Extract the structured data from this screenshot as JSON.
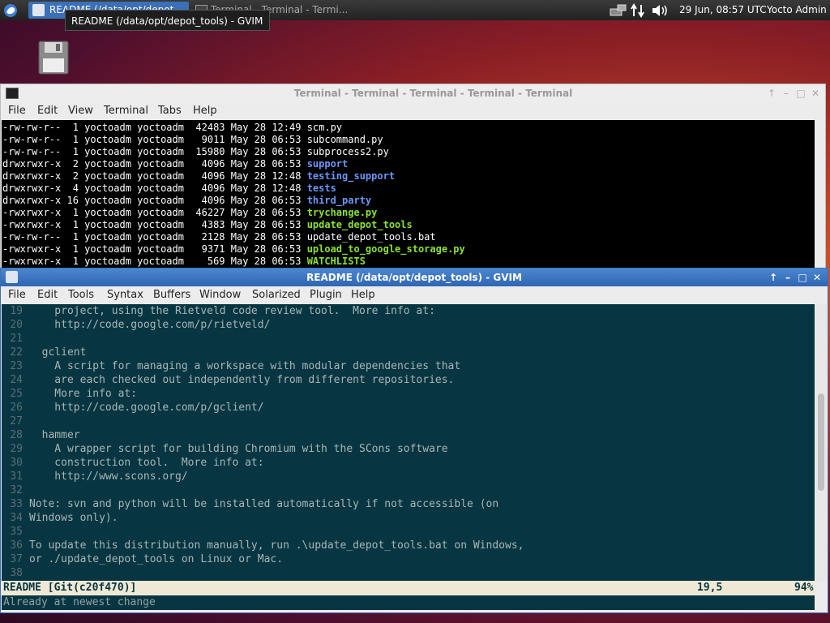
{
  "top_panel": {
    "tasks": [
      {
        "label": "README (/data/opt/depot..."
      },
      {
        "label": "Terminal - Terminal - Termi..."
      }
    ],
    "clock": "29 Jun, 08:57 UTC",
    "user": "Yocto Admin"
  },
  "tooltip": "README (/data/opt/depot_tools) - GVIM",
  "terminal": {
    "title": "Terminal - Terminal - Terminal - Terminal - Terminal",
    "menu": [
      "File",
      "Edit",
      "View",
      "Terminal",
      "Tabs",
      "Help"
    ],
    "rows": [
      {
        "meta": "-rw-rw-r--  1 yoctoadm yoctoadm  42483 May 28 12:49 ",
        "name": "scm.py",
        "kind": "file"
      },
      {
        "meta": "-rw-rw-r--  1 yoctoadm yoctoadm   9011 May 28 06:53 ",
        "name": "subcommand.py",
        "kind": "file"
      },
      {
        "meta": "-rw-rw-r--  1 yoctoadm yoctoadm  15980 May 28 06:53 ",
        "name": "subprocess2.py",
        "kind": "file"
      },
      {
        "meta": "drwxrwxr-x  2 yoctoadm yoctoadm   4096 May 28 06:53 ",
        "name": "support",
        "kind": "dir"
      },
      {
        "meta": "drwxrwxr-x  2 yoctoadm yoctoadm   4096 May 28 12:48 ",
        "name": "testing_support",
        "kind": "dir"
      },
      {
        "meta": "drwxrwxr-x  4 yoctoadm yoctoadm   4096 May 28 12:48 ",
        "name": "tests",
        "kind": "dir"
      },
      {
        "meta": "drwxrwxr-x 16 yoctoadm yoctoadm   4096 May 28 06:53 ",
        "name": "third_party",
        "kind": "dir"
      },
      {
        "meta": "-rwxrwxr-x  1 yoctoadm yoctoadm  46227 May 28 06:53 ",
        "name": "trychange.py",
        "kind": "exe"
      },
      {
        "meta": "-rwxrwxr-x  1 yoctoadm yoctoadm   4383 May 28 06:53 ",
        "name": "update_depot_tools",
        "kind": "exe"
      },
      {
        "meta": "-rw-rw-r--  1 yoctoadm yoctoadm   2128 May 28 06:53 ",
        "name": "update_depot_tools.bat",
        "kind": "file"
      },
      {
        "meta": "-rwxrwxr-x  1 yoctoadm yoctoadm   9371 May 28 06:53 ",
        "name": "upload_to_google_storage.py",
        "kind": "exe"
      },
      {
        "meta": "-rwxrwxr-x  1 yoctoadm yoctoadm    569 May 28 06:53 ",
        "name": "WATCHLISTS",
        "kind": "exe"
      }
    ]
  },
  "gvim": {
    "title": "README (/data/opt/depot_tools) - GVIM",
    "menu": [
      "File",
      "Edit",
      "Tools",
      "Syntax",
      "Buffers",
      "Window",
      "Solarized",
      "Plugin",
      "Help"
    ],
    "lines": [
      {
        "n": "19",
        "text": "    project, using the Rietveld code review tool.  More info at:"
      },
      {
        "n": "20",
        "text": "    http://code.google.com/p/rietveld/"
      },
      {
        "n": "21",
        "text": ""
      },
      {
        "n": "22",
        "text": "  gclient"
      },
      {
        "n": "23",
        "text": "    A script for managing a workspace with modular dependencies that"
      },
      {
        "n": "24",
        "text": "    are each checked out independently from different repositories."
      },
      {
        "n": "25",
        "text": "    More info at:"
      },
      {
        "n": "26",
        "text": "    http://code.google.com/p/gclient/"
      },
      {
        "n": "27",
        "text": ""
      },
      {
        "n": "28",
        "text": "  hammer"
      },
      {
        "n": "29",
        "text": "    A wrapper script for building Chromium with the SCons software"
      },
      {
        "n": "30",
        "text": "    construction tool.  More info at:"
      },
      {
        "n": "31",
        "text": "    http://www.scons.org/"
      },
      {
        "n": "32",
        "text": ""
      },
      {
        "n": "33",
        "text": "Note: svn and python will be installed automatically if not accessible (on"
      },
      {
        "n": "34",
        "text": "Windows only)."
      },
      {
        "n": "35",
        "text": ""
      },
      {
        "n": "36",
        "text": "To update this distribution manually, run .\\update_depot_tools.bat on Windows,"
      },
      {
        "n": "37",
        "text": "or ./update_depot_tools on Linux or Mac."
      },
      {
        "n": "38",
        "text": ""
      }
    ],
    "status": {
      "file": "README [Git(c20f470)]",
      "position": "19,5",
      "percent": "94%"
    },
    "cmdline": "Already at newest change"
  }
}
